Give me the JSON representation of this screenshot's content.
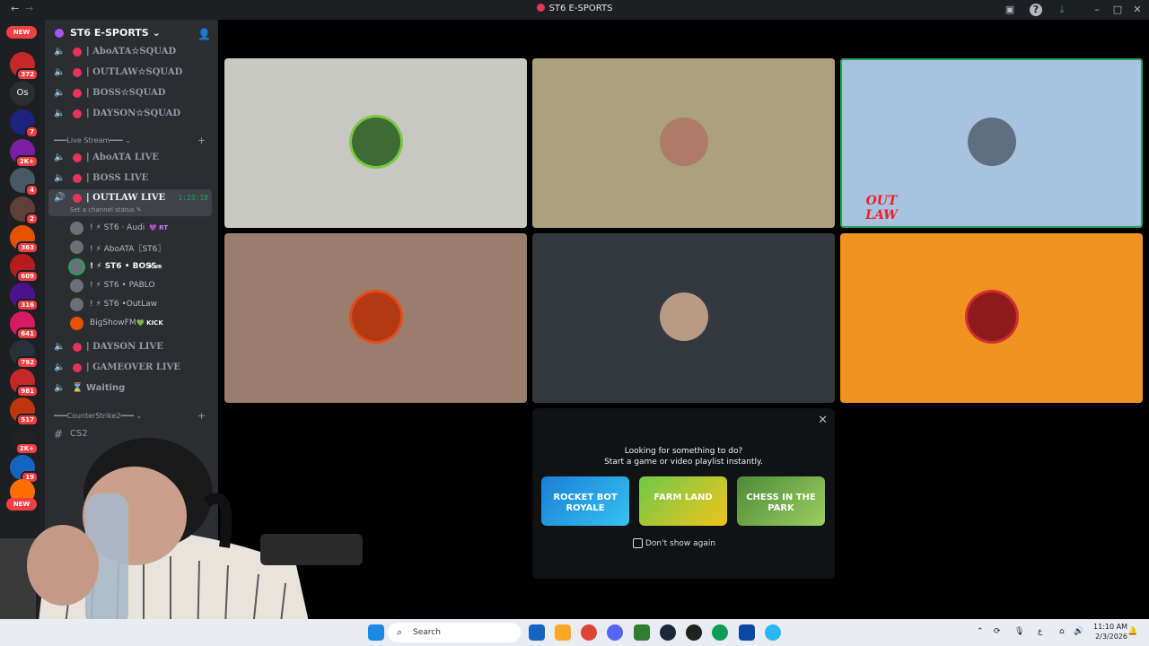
{
  "window": {
    "title": "ST6 E-SPORTS",
    "back": "←",
    "forward": "→"
  },
  "guilds": {
    "new_top": "NEW",
    "new_bottom": "NEW",
    "dm_letters": "Os",
    "badges": [
      "372",
      "7",
      "2K+",
      "4",
      "2",
      "363",
      "609",
      "316",
      "641",
      "792",
      "981",
      "517",
      "2K+",
      "19"
    ]
  },
  "sidebar": {
    "server_name": "ST6 E-SPORTS",
    "chevron": "⌄",
    "add_member": "👤",
    "channels_top": [
      {
        "label": "| AboATA☆SQUAD"
      },
      {
        "label": "| OUTLAW☆SQUAD"
      },
      {
        "label": "| BOSS☆SQUAD"
      },
      {
        "label": "| DAYSON☆SQUAD"
      }
    ],
    "category_live": "━━━Live Stream━━━",
    "channels_live": [
      {
        "label": "| AboATA LIVE"
      },
      {
        "label": "| BOSS LIVE"
      },
      {
        "label": "| OUTLAW LIVE",
        "timer": "1:23:18"
      }
    ],
    "channel_status": "Set a channel status ✎",
    "members": [
      {
        "name": "! ⚡ ST6 · Audi",
        "tag": "💜 RT"
      },
      {
        "name": "! ⚡ AboATA〖ST6〗",
        "tag": ""
      },
      {
        "name": "! ⚡ ST6 • BOSS",
        "tag": "♦ ᴊʀ"
      },
      {
        "name": "! ⚡ ST6 • PABLO",
        "tag": ""
      },
      {
        "name": "! ⚡ ST6 •OutLaw",
        "tag": ""
      },
      {
        "name": "BigShowFM",
        "tag": "💚 KICK"
      }
    ],
    "channels_bottom": [
      {
        "label": "| DAYSON LIVE",
        "dot": true
      },
      {
        "label": "| GAMEOVER LIVE",
        "dot": true
      },
      {
        "label": "Waiting",
        "dot": false
      }
    ],
    "category_cs": "━━━CounterStrike2━━━",
    "channel_cs2": "CS2",
    "plus": "+"
  },
  "stage": {
    "logo_text": "OUT LAW"
  },
  "activity_prompt": {
    "line1": "Looking for something to do?",
    "line2": "Start a game or video playlist instantly.",
    "games": [
      {
        "name": "ROCKET BOT ROYALE"
      },
      {
        "name": "FARM LAND"
      },
      {
        "name": "CHESS IN THE PARK"
      }
    ],
    "dont_show": "Don't show again",
    "close": "✕"
  },
  "taskbar": {
    "search_placeholder": "Search",
    "time": "11:10 AM",
    "date": "2/3/2026",
    "lang": "ع"
  },
  "colors": {
    "accent_red": "#f23f43",
    "speaking_green": "#23a55a",
    "tile_orange": "#f0921e"
  }
}
